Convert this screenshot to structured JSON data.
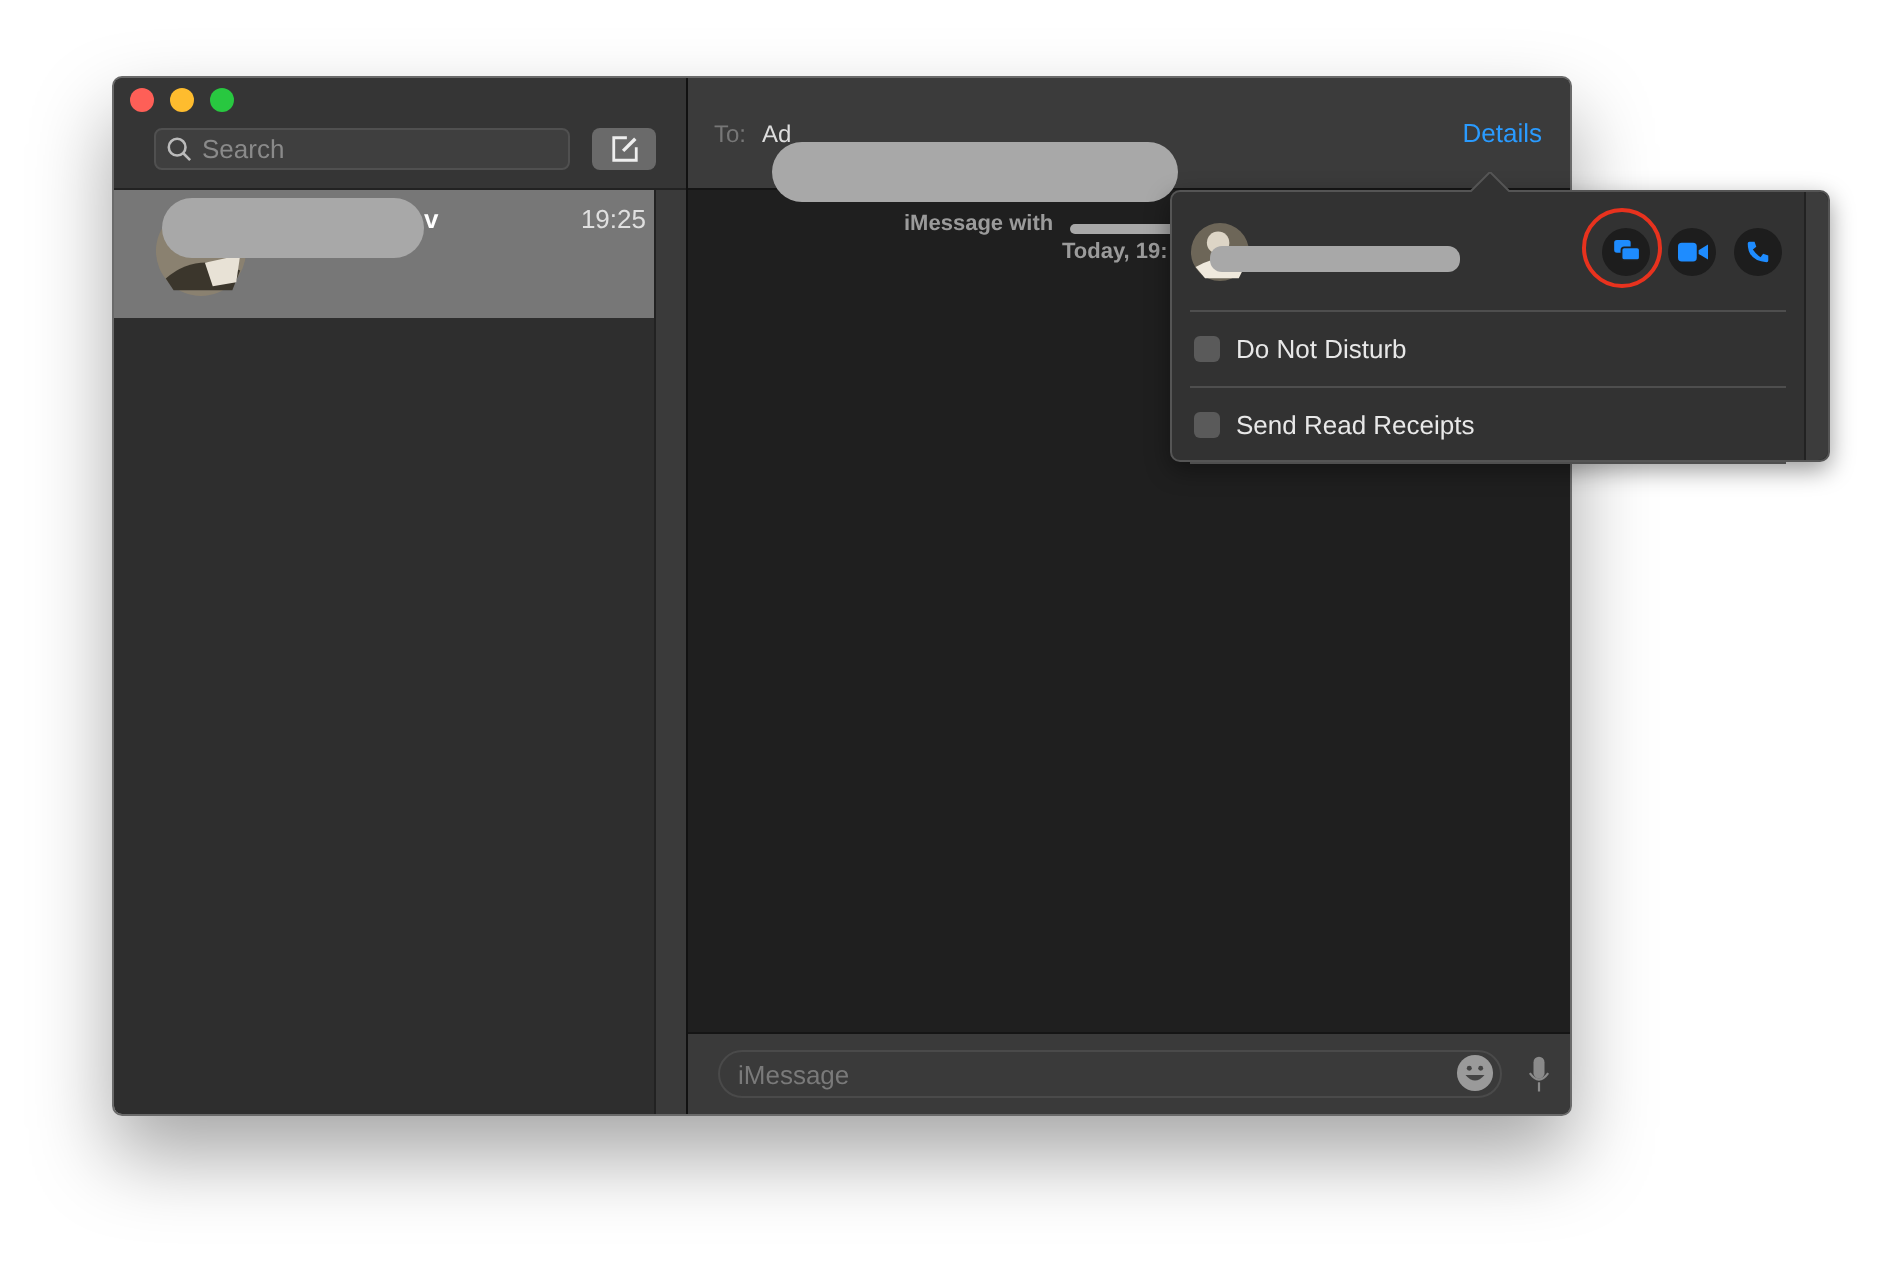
{
  "window": {
    "controls": [
      {
        "color": "#fe5f57"
      },
      {
        "color": "#febc2e"
      },
      {
        "color": "#28c840"
      }
    ]
  },
  "sidebar": {
    "search": {
      "placeholder": "Search"
    },
    "conversations": [
      {
        "name": "v",
        "time": "19:25",
        "selected": true
      }
    ]
  },
  "header": {
    "to_label": "To:",
    "recipient": "Ad",
    "details_link": "Details"
  },
  "transcript": {
    "service_line": "iMessage with",
    "date_line": "Today, 19:"
  },
  "composer": {
    "placeholder": "iMessage"
  },
  "details_popover": {
    "actions": [
      {
        "kind": "screen-share",
        "highlighted": true
      },
      {
        "kind": "video",
        "highlighted": false
      },
      {
        "kind": "phone",
        "highlighted": false
      }
    ],
    "options": [
      {
        "label": "Do Not Disturb",
        "checked": false
      },
      {
        "label": "Send Read Receipts",
        "checked": false
      }
    ]
  }
}
